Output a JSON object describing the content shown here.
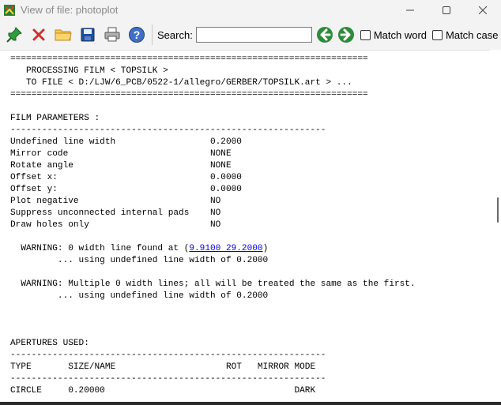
{
  "window": {
    "title": "View of file: photoplot",
    "minimize_glyph": "—",
    "maximize_glyph": "☐",
    "close_glyph": "✕"
  },
  "toolbar": {
    "search_label": "Search:",
    "search_value": "",
    "match_word_label": "Match word",
    "match_case_label": "Match case",
    "match_word_checked": false,
    "match_case_checked": false
  },
  "log": {
    "separator_top": "====================================================================",
    "processing_line": "   PROCESSING FILM < TOPSILK >",
    "to_file_line": "   TO FILE < D:/LJW/6_PCB/0522-1/allegro/GERBER/TOPSILK.art > ...",
    "separator_bottom": "====================================================================",
    "film_params_header": "FILM PARAMETERS :",
    "film_params_rule": "------------------------------------------------------------",
    "params": [
      {
        "name": "Undefined line width",
        "value": "0.2000"
      },
      {
        "name": "Mirror code",
        "value": "NONE"
      },
      {
        "name": "Rotate angle",
        "value": "NONE"
      },
      {
        "name": "Offset x:",
        "value": "0.0000"
      },
      {
        "name": "Offset y:",
        "value": "0.0000"
      },
      {
        "name": "Plot negative",
        "value": "NO"
      },
      {
        "name": "Suppress unconnected internal pads",
        "value": "NO"
      },
      {
        "name": "Draw holes only",
        "value": "NO"
      }
    ],
    "warning1_prefix": "  WARNING: 0 width line found at (",
    "warning1_link": "9.9100 29.2000",
    "warning1_suffix": ")",
    "warning1_detail": "         ... using undefined line width of 0.2000",
    "warning2": "  WARNING: Multiple 0 width lines; all will be treated the same as the first.",
    "warning2_detail": "         ... using undefined line width of 0.2000",
    "apertures_header": "APERTURES USED:",
    "apertures_rule": "------------------------------------------------------------",
    "apertures_columns": "TYPE       SIZE/NAME                     ROT   MIRROR MODE",
    "apertures_rule2": "------------------------------------------------------------",
    "aperture_rows": [
      "CIRCLE     0.20000                                    DARK"
    ]
  }
}
